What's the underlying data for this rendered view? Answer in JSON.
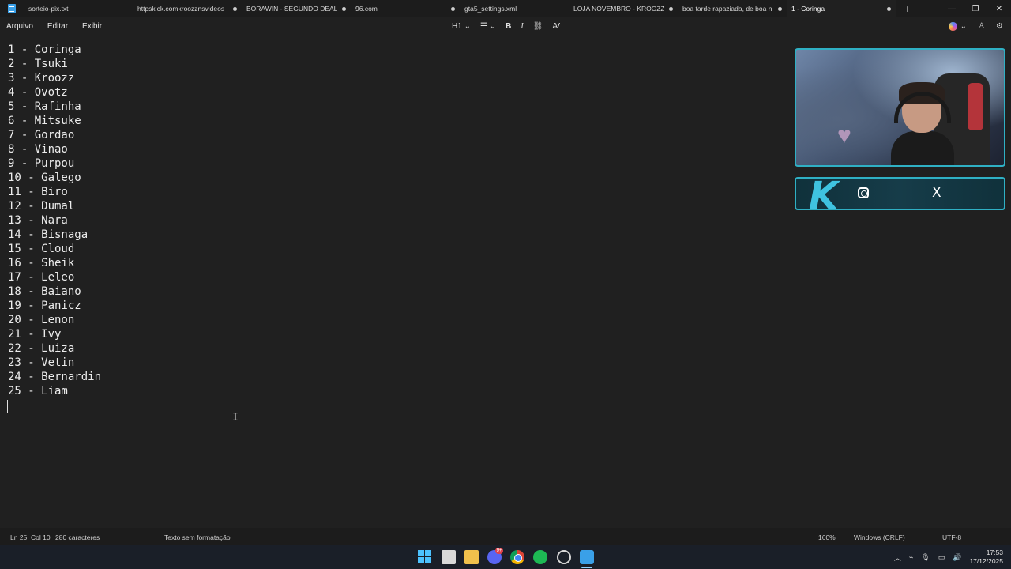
{
  "tabs": [
    {
      "label": "sorteio-pix.txt",
      "modified": false
    },
    {
      "label": "httpskick.comkroozznsvideos",
      "modified": true
    },
    {
      "label": "BORAWIN - SEGUNDO DEAL",
      "modified": true
    },
    {
      "label": "96.com",
      "modified": true
    },
    {
      "label": "gta5_settings.xml",
      "modified": false
    },
    {
      "label": "LOJA NOVEMBRO - KROOZZN",
      "modified": true
    },
    {
      "label": "boa tarde rapaziada, de boa n",
      "modified": true
    },
    {
      "label": "1 - Coringa",
      "active": true
    }
  ],
  "window": {
    "new_tab": "+",
    "minimize": "—",
    "maximize": "❐",
    "close": "✕"
  },
  "menu": {
    "file": "Arquivo",
    "edit": "Editar",
    "view": "Exibir"
  },
  "toolbar": {
    "heading": "H1",
    "list": "☰",
    "bold": "B",
    "italic": "I",
    "link": "🔗",
    "clear": "A̸"
  },
  "document": {
    "lines": [
      "1 - Coringa",
      "2 - Tsuki",
      "3 - Kroozz",
      "4 - Ovotz",
      "5 - Rafinha",
      "6 - Mitsuke",
      "7 - Gordao",
      "8 - Vinao",
      "9 - Purpou",
      "10 - Galego",
      "11 - Biro",
      "12 - Dumal",
      "13 - Nara",
      "14 - Bisnaga",
      "15 - Cloud",
      "16 - Sheik",
      "17 - Leleo",
      "18 - Baiano",
      "19 - Panicz",
      "20 - Lenon",
      "21 - Ivy",
      "22 - Luiza",
      "23 - Vetin",
      "24 - Bernardin",
      "25 - Liam"
    ]
  },
  "social": {
    "brand_letter": "K",
    "x_icon": "X"
  },
  "status": {
    "position": "Ln 25, Col 10",
    "chars": "280 caracteres",
    "format": "Texto sem formatação",
    "zoom": "160%",
    "line_ending": "Windows (CRLF)",
    "encoding": "UTF-8"
  },
  "taskbar": {
    "discord_badge": "9+",
    "time": "17:53",
    "date": "17/12/2025"
  },
  "colors": {
    "accent": "#2fb0c4",
    "background": "#202020",
    "spell_underline": "#d04040"
  }
}
